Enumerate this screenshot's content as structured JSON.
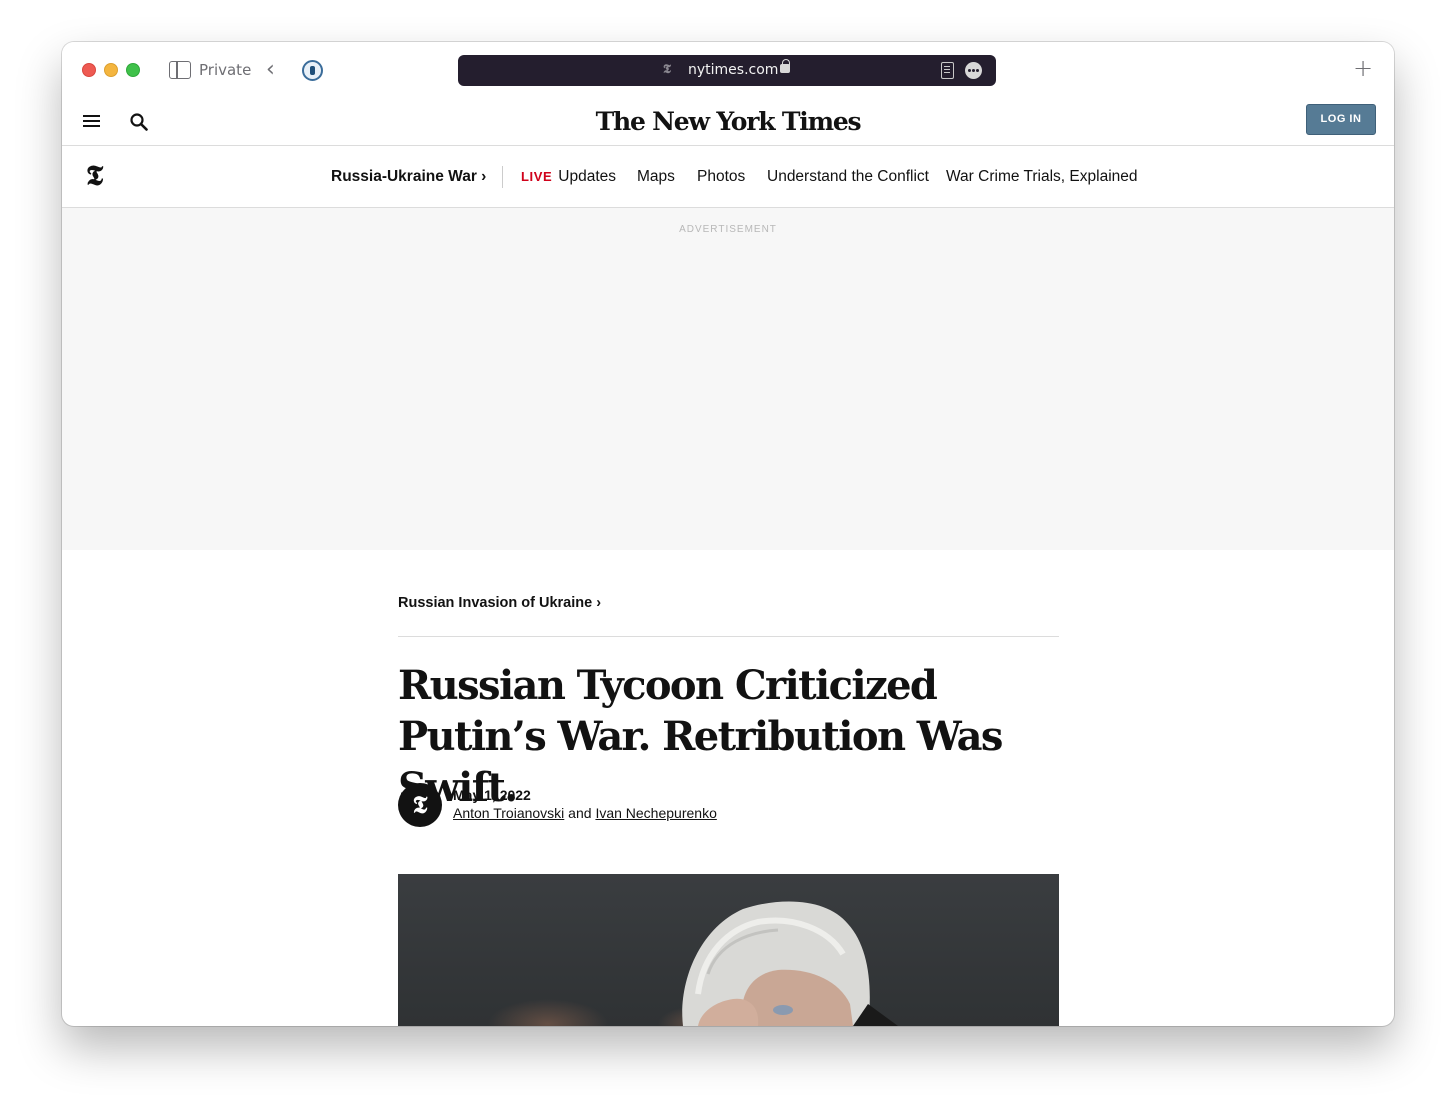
{
  "browser": {
    "private_label": "Private",
    "address": "nytimes.com",
    "favicon": "𝕿"
  },
  "masthead": {
    "logo": "The New York Times",
    "login_label": "LOG IN"
  },
  "section_nav": {
    "t_logo": "𝕿",
    "main": "Russia-Ukraine War ›",
    "live_tag": "LIVE",
    "live_label": "Updates",
    "items": [
      "Maps",
      "Photos",
      "Understand the Conflict",
      "War Crime Trials, Explained"
    ]
  },
  "ad": {
    "label": "ADVERTISEMENT"
  },
  "article": {
    "kicker": "Russian Invasion of Ukraine ›",
    "headline": "Russian Tycoon Criticized Putin’s War. Retribution Was Swift.",
    "avatar": "𝕿",
    "date": "May 1, 2022",
    "author_1": "Anton Troianovski",
    "author_conj": " and ",
    "author_2": "Ivan Nechepurenko"
  },
  "colors": {
    "live_red": "#d0021b",
    "login_blue": "#567b95",
    "address_bar_bg": "#241e2e"
  }
}
